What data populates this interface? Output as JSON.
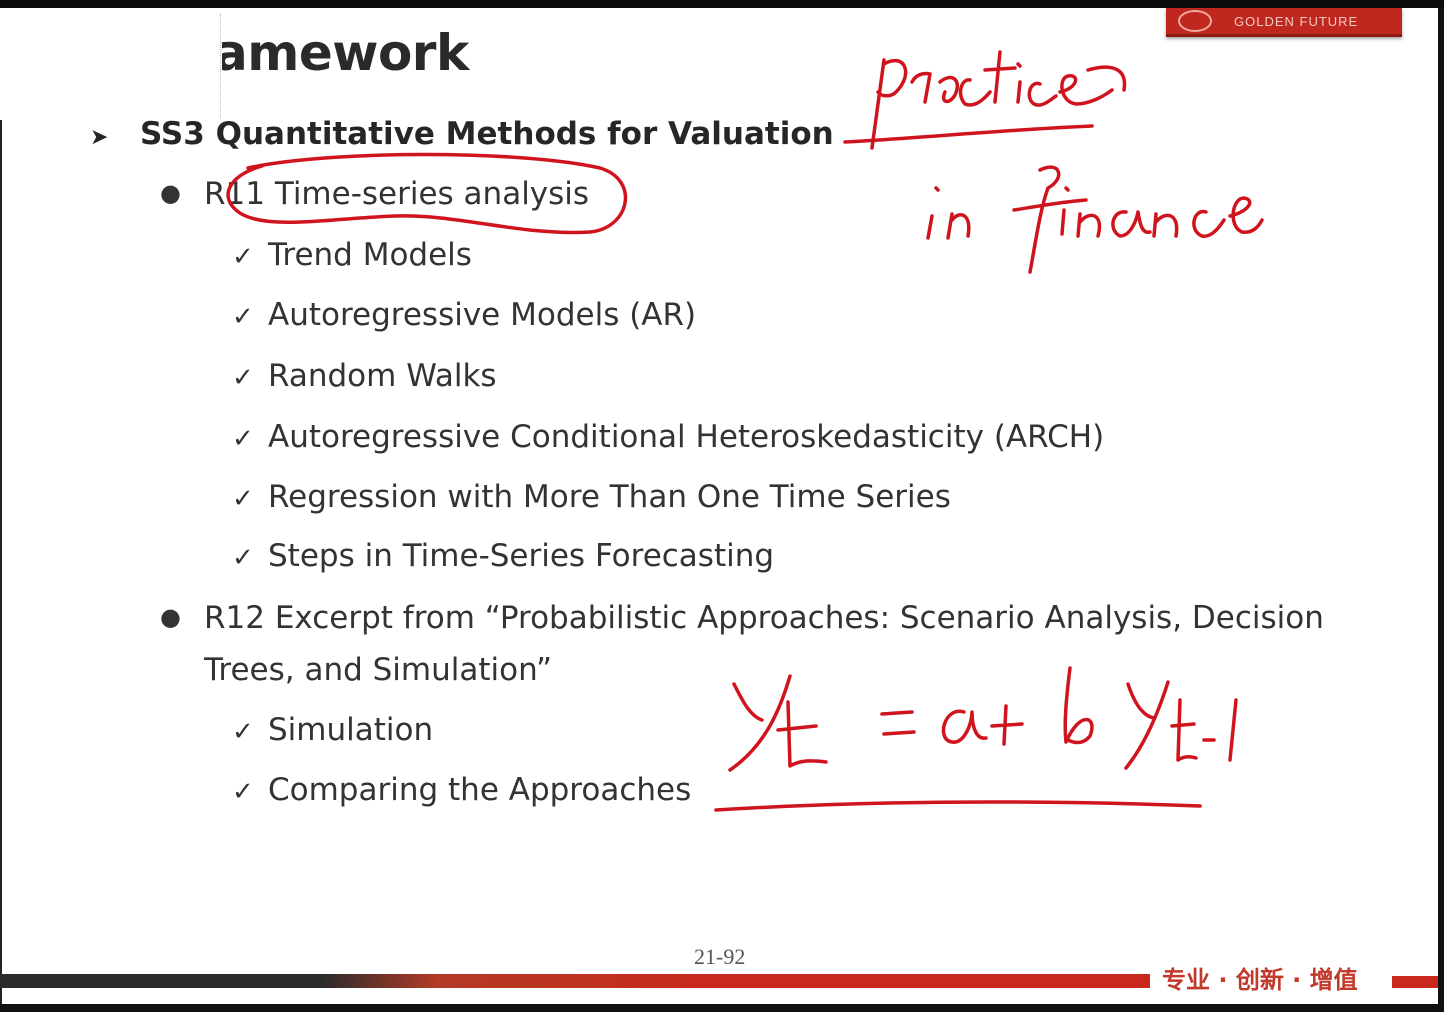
{
  "slide": {
    "title": "amework",
    "logo_text": "GOLDEN FUTURE",
    "page_number": "21-92",
    "footer_slogan": "专业 · 创新 · 增值"
  },
  "outline": {
    "session": "SS3 Quantitative Methods for Valuation",
    "readings": [
      {
        "label": "R11 Time-series analysis",
        "items": [
          "Trend Models",
          "Autoregressive Models (AR)",
          "Random Walks",
          "Autoregressive Conditional Heteroskedasticity (ARCH)",
          "Regression with More Than One Time Series",
          "Steps in Time-Series Forecasting"
        ]
      },
      {
        "label_line1": "R12 Excerpt from “Probabilistic Approaches: Scenario Analysis, Decision",
        "label_line2": "Trees, and Simulation”",
        "items": [
          "Simulation",
          "Comparing the Approaches"
        ]
      }
    ]
  },
  "annotations": {
    "ink_color": "#d0141e",
    "handwriting": [
      "practice",
      "in finance",
      "Yt = a + b Yt-1"
    ]
  },
  "colors": {
    "brand_red": "#c0271f",
    "text_dark": "#2a2a2a"
  }
}
